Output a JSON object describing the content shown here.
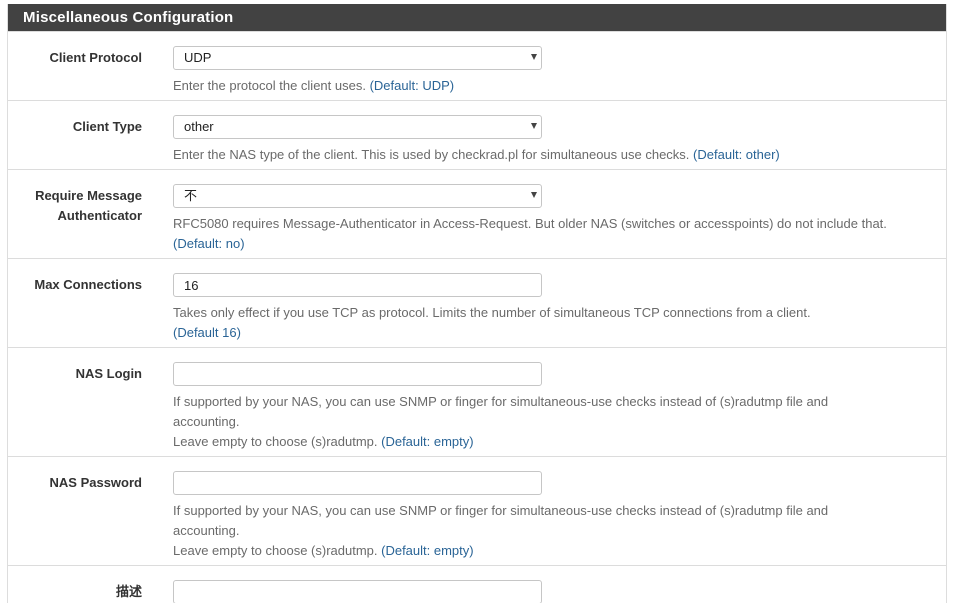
{
  "panel": {
    "title": "Miscellaneous Configuration"
  },
  "rows": {
    "client_protocol": {
      "label": "Client Protocol",
      "value": "UDP",
      "help": "Enter the protocol the client uses.",
      "default": "(Default: UDP)"
    },
    "client_type": {
      "label": "Client Type",
      "value": "other",
      "help": "Enter the NAS type of the client. This is used by checkrad.pl for simultaneous use checks.",
      "default": "(Default: other)"
    },
    "require_msg_auth": {
      "label_line1": "Require Message",
      "label_line2": "Authenticator",
      "value": "不",
      "help": "RFC5080 requires Message-Authenticator in Access-Request. But older NAS (switches or accesspoints) do not include that.",
      "default": "(Default: no)"
    },
    "max_connections": {
      "label": "Max Connections",
      "value": "16",
      "help": "Takes only effect if you use TCP as protocol. Limits the number of simultaneous TCP connections from a client.",
      "default": "(Default 16)"
    },
    "nas_login": {
      "label": "NAS Login",
      "value": "",
      "help_line1": "If supported by your NAS, you can use SNMP or finger for simultaneous-use checks instead of (s)radutmp file and accounting.",
      "help_line2": "Leave empty to choose (s)radutmp.",
      "default": "(Default: empty)"
    },
    "nas_password": {
      "label": "NAS Password",
      "value": "",
      "help_line1": "If supported by your NAS, you can use SNMP or finger for simultaneous-use checks instead of (s)radutmp file and accounting.",
      "help_line2": "Leave empty to choose (s)radutmp.",
      "default": "(Default: empty)"
    },
    "description": {
      "label": "描述",
      "value": ""
    }
  },
  "colors": {
    "header_bg": "#424242",
    "default_link": "#2a6496"
  }
}
